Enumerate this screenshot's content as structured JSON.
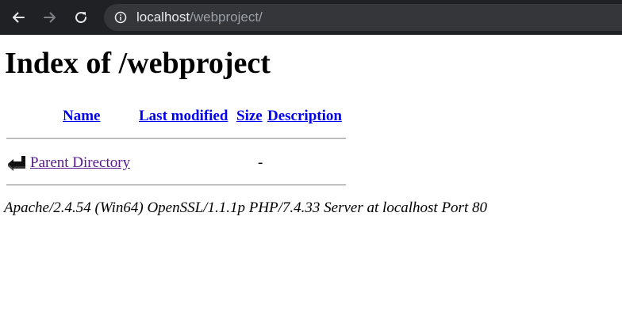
{
  "browser": {
    "url_host": "localhost",
    "url_path": "/webproject/"
  },
  "page": {
    "title": "Index of /webproject",
    "columns": {
      "name": "Name",
      "last_modified": "Last modified",
      "size": "Size",
      "description": "Description"
    },
    "rows": [
      {
        "name": "Parent Directory",
        "last_modified": "",
        "size": "-",
        "description": ""
      }
    ],
    "server_signature": "Apache/2.4.54 (Win64) OpenSSL/1.1.1p PHP/7.4.33 Server at localhost Port 80"
  },
  "colors": {
    "toolbar": "#202124",
    "omnibox": "#35363a",
    "link": "#0000ee",
    "visited_link": "#551a8b"
  }
}
